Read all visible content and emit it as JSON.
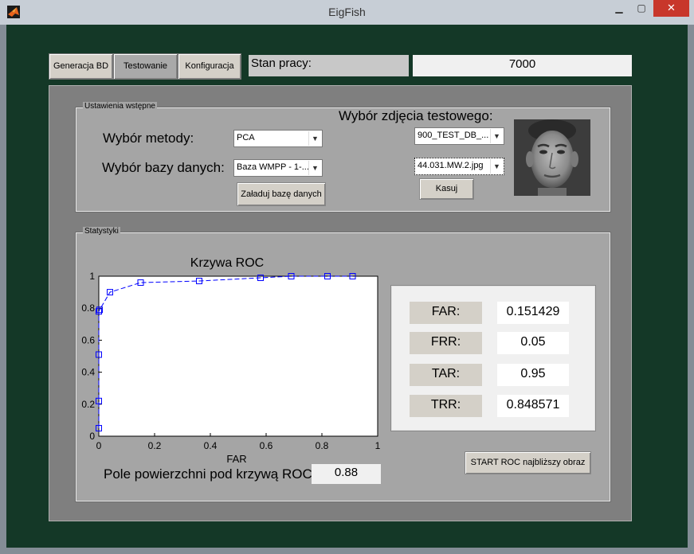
{
  "window": {
    "title": "EigFish",
    "controls": {
      "minimize": "▁",
      "maximize": "▢",
      "close": "✕"
    }
  },
  "tabs": [
    {
      "label": "Generacja BD"
    },
    {
      "label": "Testowanie"
    },
    {
      "label": "Konfiguracja"
    }
  ],
  "status": {
    "label": "Stan pracy:",
    "value": "7000"
  },
  "settings": {
    "group_title": "Ustawienia wstępne",
    "method_label": "Wybór metody:",
    "method_value": "PCA",
    "db_label": "Wybór bazy danych:",
    "db_value": "Baza WMPP - 1-...",
    "photo_label": "Wybór zdjęcia testowego:",
    "test_db_value": "900_TEST_DB_...",
    "image_value": "44.031.MW.2.jpg",
    "load_button": "Załaduj bazę danych",
    "clear_button": "Kasuj"
  },
  "stats": {
    "group_title": "Statystyki",
    "area_label": "Pole powierzchni pod krzywą ROC:",
    "area_value": "0.88",
    "far_label": "FAR:",
    "far_value": "0.151429",
    "frr_label": "FRR:",
    "frr_value": "0.05",
    "tar_label": "TAR:",
    "tar_value": "0.95",
    "trr_label": "TRR:",
    "trr_value": "0.848571",
    "roc_button": "START ROC najbliższy obraz"
  },
  "chart_data": {
    "type": "line",
    "title": "Krzywa ROC",
    "xlabel": "FAR",
    "ylabel": "",
    "xlim": [
      0,
      1
    ],
    "ylim": [
      0,
      1
    ],
    "xticks": [
      "0",
      "0.2",
      "0.4",
      "0.6",
      "0.8",
      "1"
    ],
    "yticks": [
      "0",
      "0.2",
      "0.4",
      "0.6",
      "0.8",
      "1"
    ],
    "grid": false,
    "series": [
      {
        "color": "#0000ff",
        "marker": "square",
        "x": [
          0,
          0,
          0,
          0,
          0.003,
          0.04,
          0.15,
          0.36,
          0.58,
          0.69,
          0.82,
          0.91
        ],
        "y": [
          0.05,
          0.22,
          0.51,
          0.78,
          0.79,
          0.9,
          0.96,
          0.97,
          0.99,
          1.0,
          1.0,
          1.0
        ]
      }
    ]
  },
  "colors": {
    "client_bg": "#143827",
    "panel_bg": "#a5a5a5",
    "curve": "#0000ff"
  },
  "icons": {
    "app": "matlab-icon",
    "face": "test-face-image"
  }
}
